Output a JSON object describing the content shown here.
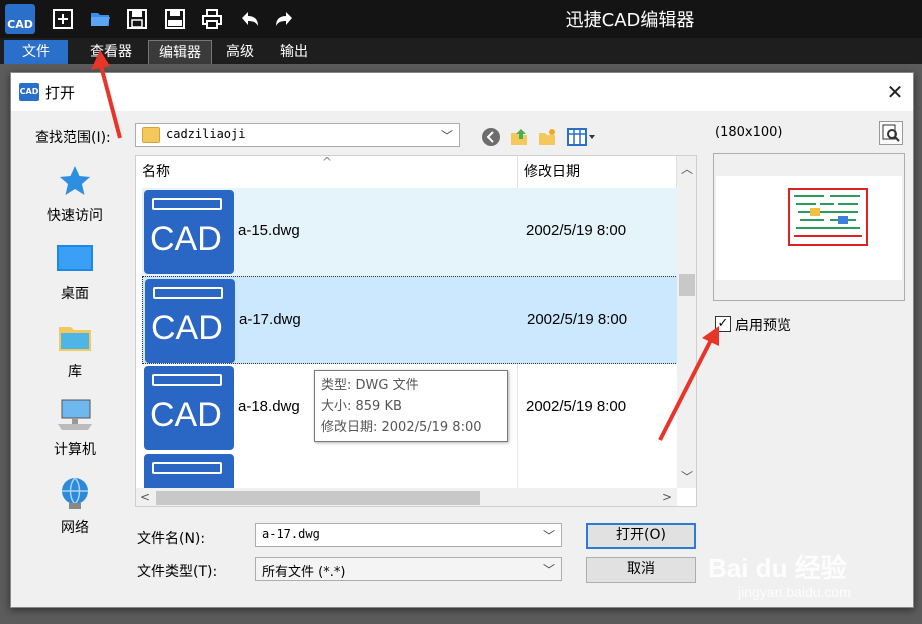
{
  "app": {
    "title": "迅捷CAD编辑器",
    "logo_text": "CAD",
    "menu": [
      "文件",
      "查看器",
      "编辑器",
      "高级",
      "输出"
    ]
  },
  "dialog": {
    "title": "打开",
    "icon_text": "CAD",
    "look_in_label": "查找范围(I):",
    "look_in_value": "cadziliaoji",
    "columns": {
      "name": "名称",
      "date": "修改日期"
    },
    "places": [
      {
        "label": "快速访问",
        "icon": "star-icon"
      },
      {
        "label": "桌面",
        "icon": "desktop-icon"
      },
      {
        "label": "库",
        "icon": "library-icon"
      },
      {
        "label": "计算机",
        "icon": "computer-icon"
      },
      {
        "label": "网络",
        "icon": "network-icon"
      }
    ],
    "files": [
      {
        "name": "a-15.dwg",
        "date": "2002/5/19 8:00",
        "thumb_text": "CAD"
      },
      {
        "name": "a-17.dwg",
        "date": "2002/5/19 8:00",
        "thumb_text": "CAD"
      },
      {
        "name": "a-18.dwg",
        "date": "2002/5/19 8:00",
        "thumb_text": "CAD"
      },
      {
        "name": "",
        "date": "",
        "thumb_text": ""
      }
    ],
    "tooltip": {
      "type": "类型: DWG 文件",
      "size": "大小: 859 KB",
      "modified": "修改日期: 2002/5/19 8:00"
    },
    "preview_size": "(180x100)",
    "enable_preview_label": "启用预览",
    "filename_label": "文件名(N):",
    "filename_value": "a-17.dwg",
    "filetype_label": "文件类型(T):",
    "filetype_value": "所有文件 (*.*)",
    "open_button": "打开(O)",
    "cancel_button": "取消"
  },
  "watermark": {
    "brand": "Bai du 经验",
    "url": "jingyan.baidu.com"
  },
  "colors": {
    "accent": "#2a6fc9",
    "selection": "#cce8ff",
    "hover": "#e5f3fb",
    "annotation_arrow": "#e8352a"
  }
}
